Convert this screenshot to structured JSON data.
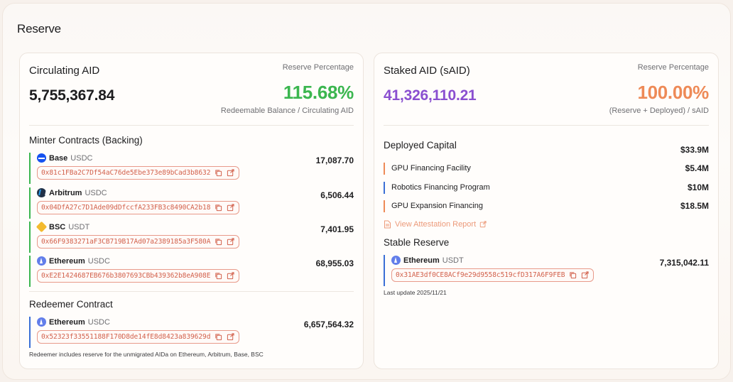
{
  "page": {
    "title": "Reserve"
  },
  "circulating": {
    "title": "Circulating AID",
    "reserve_label": "Reserve Percentage",
    "value": "5,755,367.84",
    "percentage": "115.68%",
    "percentage_sub": "Redeemable Balance / Circulating AID",
    "minter_title": "Minter Contracts (Backing)",
    "minters": [
      {
        "chain": "Base",
        "token": "USDC",
        "icon": "base-icon",
        "address": "0x81c1FBa2C7Df54aC76de5Ebe373e89bCad3b8632",
        "amount": "17,087.70"
      },
      {
        "chain": "Arbitrum",
        "token": "USDC",
        "icon": "arbitrum-icon",
        "address": "0x04DfA27c7D1Ade09dDfccfA233FB3c8490CA2b18",
        "amount": "6,506.44"
      },
      {
        "chain": "BSC",
        "token": "USDT",
        "icon": "bsc-icon",
        "address": "0x66F9383271aF3CB719B17Ad07a2389185a3F580A",
        "amount": "7,401.95"
      },
      {
        "chain": "Ethereum",
        "token": "USDC",
        "icon": "ethereum-icon",
        "address": "0xE2E1424687EB676b3807693CBb439362b8eA908E",
        "amount": "68,955.03"
      }
    ],
    "redeemer_title": "Redeemer Contract",
    "redeemer": {
      "chain": "Ethereum",
      "token": "USDC",
      "icon": "ethereum-icon",
      "address": "0x52323f33551188F170D8de14fE8d8423a839629d",
      "amount": "6,657,564.32"
    },
    "footnote": "Redeemer includes reserve for the unmigrated AIDa on Ethereum, Arbitrum, Base, BSC"
  },
  "staked": {
    "title": "Staked AID (sAID)",
    "reserve_label": "Reserve Percentage",
    "value": "41,326,110.21",
    "percentage": "100.00%",
    "percentage_sub": "(Reserve + Deployed) / sAID",
    "deployed_title": "Deployed Capital",
    "deployed_total": "$33.9M",
    "deployed": [
      {
        "name": "GPU Financing Facility",
        "amount": "$5.4M"
      },
      {
        "name": "Robotics Financing Program",
        "amount": "$10M"
      },
      {
        "name": "GPU Expansion Financing",
        "amount": "$18.5M"
      }
    ],
    "attestation_label": "View Attestation Report",
    "stable_title": "Stable Reserve",
    "stable": {
      "chain": "Ethereum",
      "token": "USDT",
      "icon": "ethereum-icon",
      "address": "0x31AE3df0CE8ACf9e29d9558c519cfD317A6F9FEB",
      "amount": "7,315,042.11"
    },
    "last_update": "Last update 2025/11/21"
  },
  "colors": {
    "green": "#3bb64f",
    "orange": "#ee8a57",
    "purple": "#8a4fd0",
    "blue": "#3a6fd6",
    "address": "#d2614c"
  }
}
